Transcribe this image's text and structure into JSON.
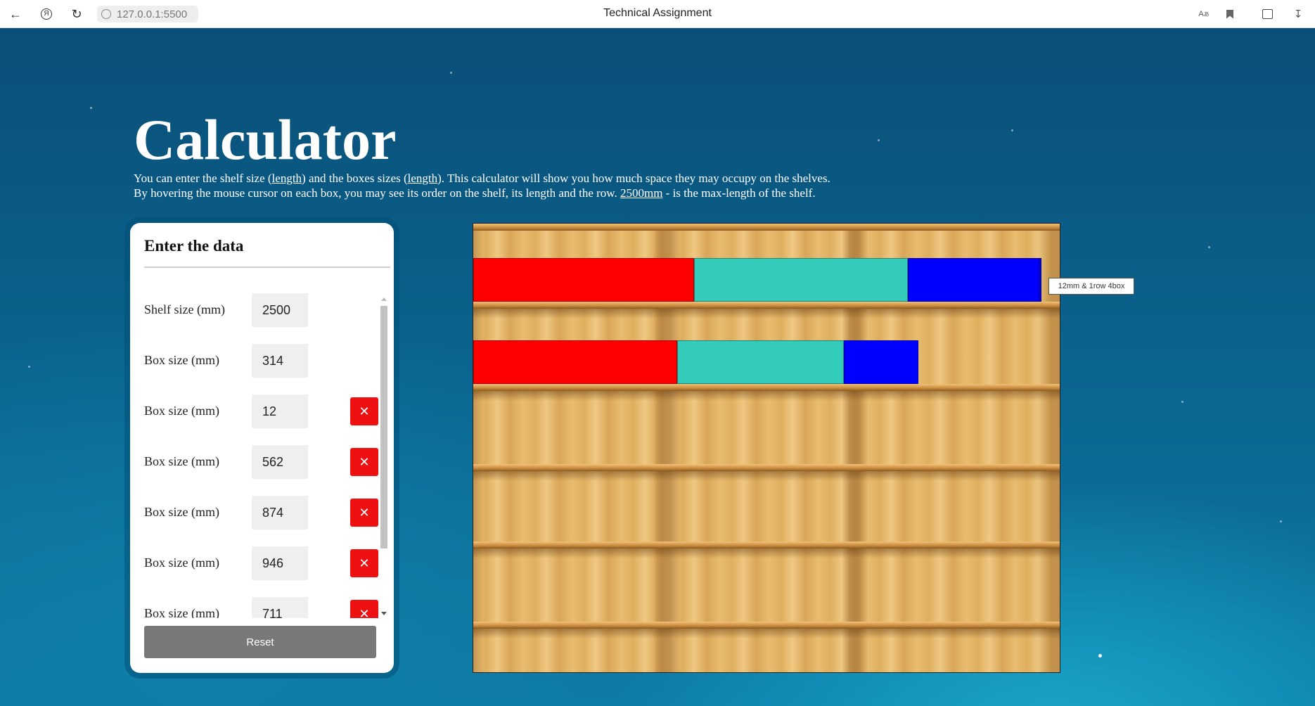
{
  "browser": {
    "url": "127.0.0.1:5500",
    "tab_title": "Technical Assignment",
    "icons": [
      "back-arrow-icon",
      "yandex-icon",
      "reload-icon",
      "site-info-icon",
      "translate-icon",
      "bookmark-icon",
      "collections-icon",
      "download-icon"
    ]
  },
  "header": {
    "title": "Calculator",
    "line1_a": "You can enter the shelf size (",
    "line1_link1": "length",
    "line1_b": ") and the boxes sizes (",
    "line1_link2": "length",
    "line1_c": "). This calculator will show you how much space they may occupy on the shelves.",
    "line2_a": "By hovering the mouse cursor on each box, you may see its order on the shelf, its length and the row. ",
    "line2_link": "2500mm",
    "line2_b": " - is the max-length of the shelf."
  },
  "form": {
    "title": "Enter the data",
    "shelf_label": "Shelf size (mm)",
    "shelf_value": "2500",
    "box_label": "Box size (mm)",
    "boxes": [
      "314",
      "12",
      "562",
      "874",
      "946",
      "711"
    ],
    "delete_symbol": "✕",
    "reset_label": "Reset"
  },
  "shelf": {
    "colors": {
      "red": "#ff0000",
      "teal": "#33ccbb",
      "blue": "#0000ff"
    },
    "tooltip": "12mm & 1row 4box"
  }
}
